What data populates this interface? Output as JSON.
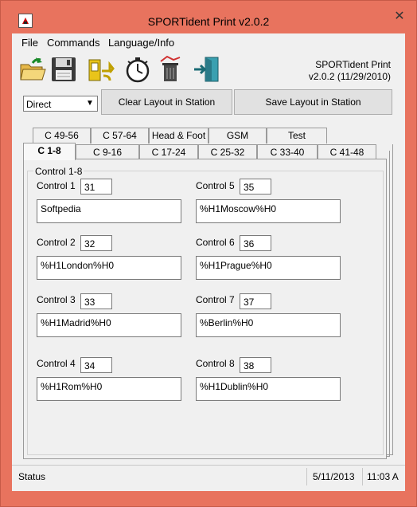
{
  "window": {
    "title": "SPORTident Print v2.0.2",
    "close_glyph": "✕"
  },
  "menu": {
    "items": [
      "File",
      "Commands",
      "Language/Info"
    ]
  },
  "toolbar": {
    "icons": [
      "open-folder-icon",
      "save-disk-icon",
      "download-from-station-icon",
      "stopwatch-icon",
      "clear-trash-icon",
      "exit-door-icon"
    ]
  },
  "version": {
    "line1": "SPORTident Print",
    "line2": "v2.0.2 (11/29/2010)"
  },
  "connection": {
    "selected": "Direct"
  },
  "buttons": {
    "clear_layout": "Clear Layout in Station",
    "save_layout": "Save Layout in Station"
  },
  "tabs": {
    "back_row": [
      "C 49-56",
      "C 57-64",
      "Head & Foot",
      "GSM",
      "Test"
    ],
    "front_row": [
      "C 1-8",
      "C 9-16",
      "C 17-24",
      "C 25-32",
      "C 33-40",
      "C 41-48"
    ],
    "active": "C 1-8"
  },
  "group": {
    "title": "Control 1-8"
  },
  "controls": [
    {
      "label": "Control 1",
      "number": "31",
      "text": "Softpedia"
    },
    {
      "label": "Control 2",
      "number": "32",
      "text": "%H1London%H0"
    },
    {
      "label": "Control 3",
      "number": "33",
      "text": "%H1Madrid%H0"
    },
    {
      "label": "Control 4",
      "number": "34",
      "text": "%H1Rom%H0"
    },
    {
      "label": "Control 5",
      "number": "35",
      "text": "%H1Moscow%H0"
    },
    {
      "label": "Control 6",
      "number": "36",
      "text": "%H1Prague%H0"
    },
    {
      "label": "Control 7",
      "number": "37",
      "text": "%Berlin%H0"
    },
    {
      "label": "Control 8",
      "number": "38",
      "text": "%H1Dublin%H0"
    }
  ],
  "status": {
    "text": "Status",
    "date": "5/11/2013",
    "time": "11:03 A"
  },
  "colors": {
    "window_frame": "#e8735e",
    "client_bg": "#f0f0f0"
  }
}
